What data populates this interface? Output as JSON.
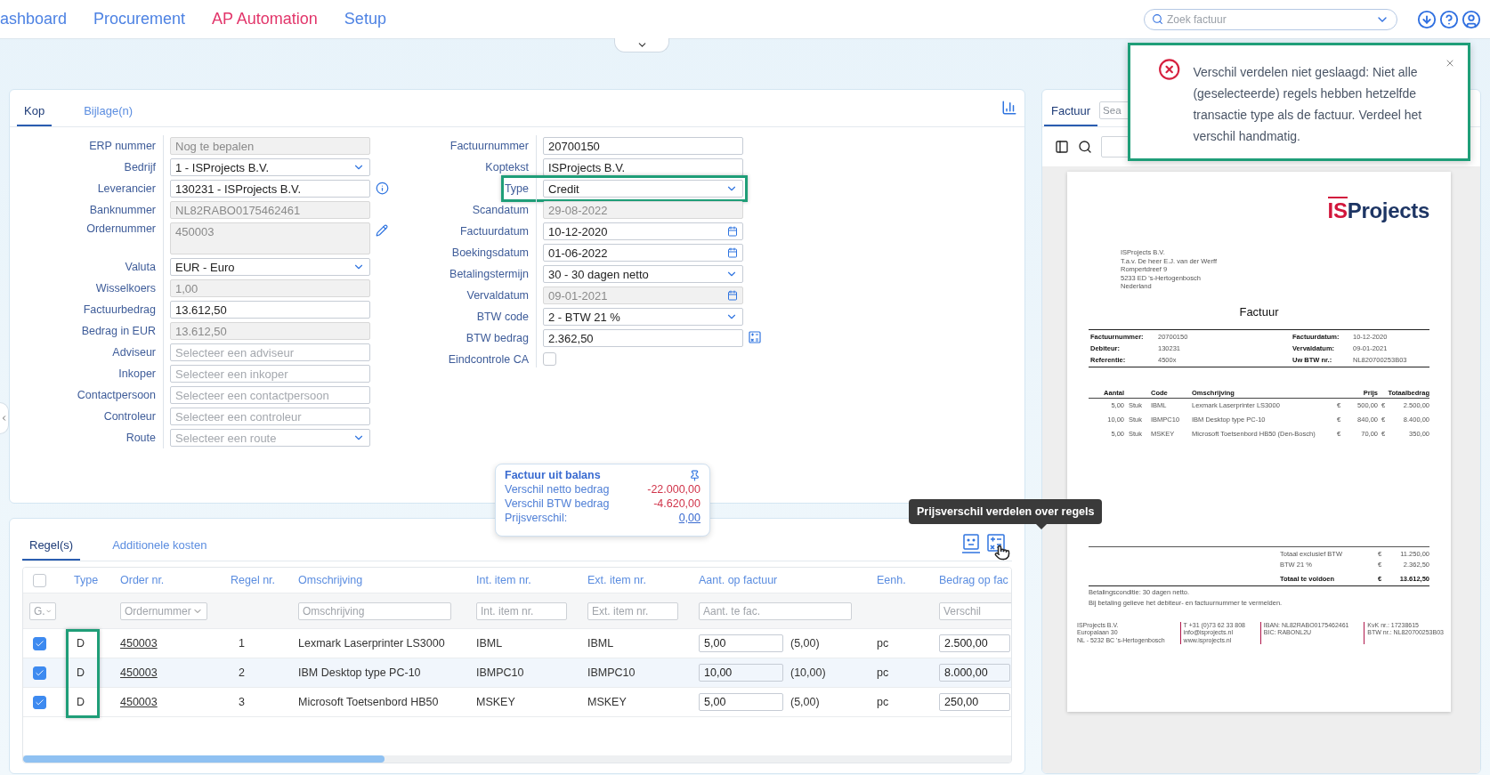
{
  "nav": {
    "items": [
      {
        "label": "ashboard",
        "selected": false
      },
      {
        "label": "Procurement",
        "selected": false
      },
      {
        "label": "AP Automation",
        "selected": true
      },
      {
        "label": "Setup",
        "selected": false
      }
    ],
    "search": {
      "placeholder": "Zoek factuur"
    }
  },
  "header_form": {
    "tabs": [
      {
        "label": "Kop",
        "selected": true
      },
      {
        "label": "Bijlage(n)",
        "selected": false
      }
    ],
    "left_fields": [
      {
        "label": "ERP nummer",
        "kind": "text",
        "value": "Nog te bepalen",
        "disabled": true
      },
      {
        "label": "Bedrijf",
        "kind": "select",
        "value": "1 - ISProjects B.V.",
        "disabled": false
      },
      {
        "label": "Leverancier",
        "kind": "text",
        "value": "130231 - ISProjects B.V.",
        "disabled": false,
        "info_button": true
      },
      {
        "label": "Banknummer",
        "kind": "text",
        "value": "NL82RABO0175462461",
        "disabled": true
      },
      {
        "label": "Ordernummer",
        "kind": "textarea",
        "value": "450003",
        "disabled": true,
        "edit_button": true
      },
      {
        "label": "Valuta",
        "kind": "select",
        "value": "EUR - Euro",
        "disabled": false
      },
      {
        "label": "Wisselkoers",
        "kind": "text",
        "value": "1,00",
        "disabled": true
      },
      {
        "label": "Factuurbedrag",
        "kind": "text",
        "value": "13.612,50",
        "disabled": false
      },
      {
        "label": "Bedrag in EUR",
        "kind": "text",
        "value": "13.612,50",
        "disabled": true
      },
      {
        "label": "Adviseur",
        "kind": "text",
        "placeholder": "Selecteer een adviseur",
        "disabled": false
      },
      {
        "label": "Inkoper",
        "kind": "text",
        "placeholder": "Selecteer een inkoper",
        "disabled": false
      },
      {
        "label": "Contactpersoon",
        "kind": "text",
        "placeholder": "Selecteer een contactpersoon",
        "disabled": false
      },
      {
        "label": "Controleur",
        "kind": "text",
        "placeholder": "Selecteer een controleur",
        "disabled": false
      },
      {
        "label": "Route",
        "kind": "select",
        "placeholder": "Selecteer een route",
        "disabled": false
      }
    ],
    "right_fields": [
      {
        "label": "Factuurnummer",
        "kind": "text",
        "value": "20700150",
        "disabled": false
      },
      {
        "label": "Koptekst",
        "kind": "text",
        "value": "ISProjects B.V.",
        "disabled": false
      },
      {
        "label": "Type",
        "kind": "select",
        "value": "Credit",
        "disabled": false,
        "highlighted": true
      },
      {
        "label": "Scandatum",
        "kind": "text",
        "value": "29-08-2022",
        "disabled": true
      },
      {
        "label": "Factuurdatum",
        "kind": "date",
        "value": "10-12-2020",
        "disabled": false
      },
      {
        "label": "Boekingsdatum",
        "kind": "date",
        "value": "01-06-2022",
        "disabled": false
      },
      {
        "label": "Betalingstermijn",
        "kind": "select",
        "value": "30 - 30 dagen netto",
        "disabled": false
      },
      {
        "label": "Vervaldatum",
        "kind": "date",
        "value": "09-01-2021",
        "disabled": true
      },
      {
        "label": "BTW code",
        "kind": "select",
        "value": "2 - BTW 21 %",
        "disabled": false
      },
      {
        "label": "BTW bedrag",
        "kind": "text",
        "value": "2.362,50",
        "disabled": false,
        "calculator_button": true
      },
      {
        "label": "Eindcontrole CA",
        "kind": "checkbox",
        "checked": false,
        "disabled": false
      }
    ]
  },
  "balance": {
    "title": "Factuur uit balans",
    "rows": [
      {
        "label": "Verschil netto bedrag",
        "value": "-22.000,00",
        "kind": "negative"
      },
      {
        "label": "Verschil BTW bedrag",
        "value": "-4.620,00",
        "kind": "negative"
      },
      {
        "label": "Prijsverschil:",
        "value": "0,00",
        "kind": "link"
      }
    ]
  },
  "lines": {
    "tabs": [
      {
        "label": "Regel(s)",
        "selected": true
      },
      {
        "label": "Additionele kosten",
        "selected": false
      }
    ],
    "tooltip": "Prijsverschil verdelen over regels",
    "columns": [
      {
        "kind": "checkbox",
        "checked": false,
        "filter": {
          "kind": "select",
          "placeholder": "G."
        }
      },
      {
        "kind": "text",
        "label": "Type",
        "highlighted": true
      },
      {
        "kind": "text",
        "label": "Order nr.",
        "filter": {
          "kind": "select",
          "placeholder": "Ordernummer"
        }
      },
      {
        "kind": "text",
        "label": "Regel nr."
      },
      {
        "kind": "text",
        "label": "Omschrijving",
        "filter": {
          "kind": "text",
          "placeholder": "Omschrijving"
        }
      },
      {
        "kind": "text",
        "label": "Int. item nr.",
        "filter": {
          "kind": "text",
          "placeholder": "Int. item nr."
        }
      },
      {
        "kind": "text",
        "label": "Ext. item nr.",
        "filter": {
          "kind": "text",
          "placeholder": "Ext. item nr."
        }
      },
      {
        "kind": "text",
        "label": "Aant. op factuur",
        "filter": {
          "kind": "text",
          "placeholder": "Aant. te fac."
        }
      },
      {
        "kind": "text",
        "label": "Eenh."
      },
      {
        "kind": "text",
        "label": "Bedrag op fac",
        "filter": {
          "kind": "text",
          "placeholder": "Verschil"
        }
      }
    ],
    "rows": [
      {
        "selected": true,
        "hovered": false,
        "type": "D",
        "order": "450003",
        "line": "1",
        "description": "Lexmark Laserprinter LS3000",
        "int_item": "IBML",
        "ext_item": "IBML",
        "quantity": "5,00",
        "quantity_expected": "(5,00)",
        "unit": "pc",
        "amount": "2.500,00"
      },
      {
        "selected": true,
        "hovered": true,
        "type": "D",
        "order": "450003",
        "line": "2",
        "description": "IBM Desktop type PC-10",
        "int_item": "IBMPC10",
        "ext_item": "IBMPC10",
        "quantity": "10,00",
        "quantity_expected": "(10,00)",
        "unit": "pc",
        "amount": "8.000,00"
      },
      {
        "selected": true,
        "hovered": false,
        "type": "D",
        "order": "450003",
        "line": "3",
        "description": "Microsoft Toetsenbord HB50",
        "int_item": "MSKEY",
        "ext_item": "MSKEY",
        "quantity": "5,00",
        "quantity_expected": "(5,00)",
        "unit": "pc",
        "amount": "250,00"
      }
    ]
  },
  "viewer": {
    "tabs": [
      {
        "label": "Factuur",
        "selected": true
      }
    ],
    "search": {
      "placeholder": "Sea"
    },
    "document": {
      "logo": {
        "part_1": "IS",
        "part_2": "Projects"
      },
      "address": [
        "ISProjects B.V.",
        "T.a.v. De heer E.J. van der Werff",
        "Rompertdreef 9",
        "5233 ED  's-Hertogenbosch",
        "Nederland"
      ],
      "title": "Factuur",
      "meta_left": [
        {
          "label": "Factuurnummer:",
          "value": "20700150"
        },
        {
          "label": "Debiteur:",
          "value": "130231"
        },
        {
          "label": "Referentie:",
          "value": "4500x"
        }
      ],
      "meta_right": [
        {
          "label": "Factuurdatum:",
          "value": "10-12-2020"
        },
        {
          "label": "Vervaldatum:",
          "value": "09-01-2021"
        },
        {
          "label": "Uw BTW nr.:",
          "value": "NL820700253B03"
        }
      ],
      "columns": [
        "Aantal",
        "Code",
        "Omschrijving",
        "Prijs",
        "Totaalbedrag"
      ],
      "lines": [
        {
          "qty": "5,00",
          "unit": "Stuk",
          "code": "IBML",
          "description": "Lexmark Laserprinter LS3000",
          "currency": "€",
          "price": "500,00",
          "currency_total": "€",
          "total": "2.500,00"
        },
        {
          "qty": "10,00",
          "unit": "Stuk",
          "code": "IBMPC10",
          "description": "IBM Desktop type PC-10",
          "currency": "€",
          "price": "840,00",
          "currency_total": "€",
          "total": "8.400,00"
        },
        {
          "qty": "5,00",
          "unit": "Stuk",
          "code": "MSKEY",
          "description": "Microsoft Toetsenbord HB50 (Den-Bosch)",
          "currency": "€",
          "price": "70,00",
          "currency_total": "€",
          "total": "350,00"
        }
      ],
      "totals": [
        {
          "label": "Totaal exclusief BTW",
          "currency": "€",
          "amount": "11.250,00",
          "bold": false
        },
        {
          "label": "BTW 21 %",
          "currency": "€",
          "amount": "2.362,50",
          "bold": false
        },
        {
          "label": "Totaal te voldoen",
          "currency": "€",
          "amount": "13.612,50",
          "bold": true
        }
      ],
      "notes": [
        "Betalingsconditie: 30 dagen netto.",
        "Bij betaling gelieve het debiteur- en factuurnummer te vermelden."
      ],
      "footer": [
        [
          "ISProjects B.V.",
          "Europalaan 30",
          "NL - 5232 BC 's-Hertogenbosch"
        ],
        [
          "T +31 (0)73 62 33 808",
          "info@isprojects.nl",
          "www.isprojects.nl"
        ],
        [
          "IBAN: NL82RABO0175462461",
          "BIC: RABONL2U"
        ],
        [
          "KvK nr.: 17238615",
          "BTW nr.: NL820700253B03"
        ]
      ]
    }
  },
  "toast": {
    "kind": "error",
    "message": "Verschil verdelen niet geslaagd: Niet alle (geselecteerde) regels hebben hetzelfde transactie type als de factuur. Verdeel het verschil handmatig."
  }
}
